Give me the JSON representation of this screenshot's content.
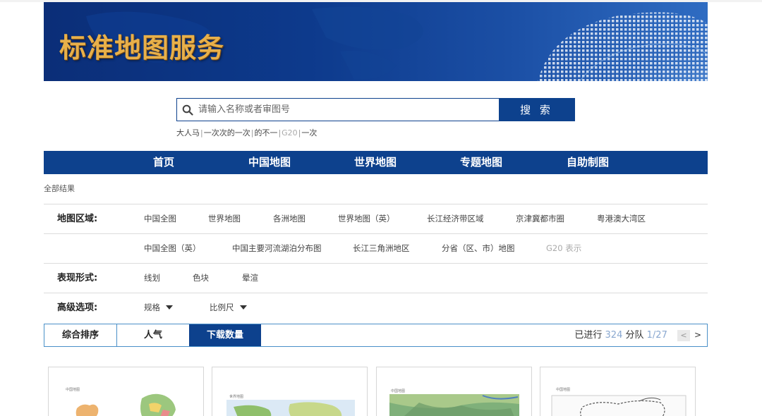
{
  "banner": {
    "title": "标准地图服务"
  },
  "search": {
    "placeholder": "请输入名称或者审图号",
    "button_label": "搜 索",
    "hot_words": [
      "大人马",
      "一次次的一次",
      "的不一",
      "G20",
      "一次"
    ]
  },
  "nav": {
    "items": [
      "首页",
      "中国地图",
      "世界地图",
      "专题地图",
      "自助制图"
    ]
  },
  "breadcrumb": "全部结果",
  "filters": {
    "region": {
      "label": "地图区域:",
      "row1": [
        "中国全图",
        "世界地图",
        "各洲地图",
        "世界地图（英）",
        "长江经济带区域",
        "京津冀都市圈",
        "粤港澳大湾区"
      ],
      "row2": [
        "中国全图（英）",
        "中国主要河流湖泊分布图",
        "长江三角洲地区",
        "分省（区、市）地图",
        "G20 表示"
      ]
    },
    "style": {
      "label": "表现形式:",
      "options": [
        "线划",
        "色块",
        "晕渲"
      ]
    },
    "advanced": {
      "label": "高级选项:",
      "options": [
        "规格",
        "比例尺"
      ]
    }
  },
  "sort": {
    "tabs": [
      "综合排序",
      "人气",
      "下载数量"
    ],
    "active": "下载数量"
  },
  "pager": {
    "prefix": "已进行",
    "total": "324",
    "mid": "分队",
    "page": "1/27",
    "prev": "<",
    "next": ">"
  },
  "cards": [
    {
      "title": "中国地图"
    },
    {
      "title": "世界地图"
    },
    {
      "title": "中国地图"
    },
    {
      "title": "中国地图"
    }
  ],
  "colors": {
    "brand": "#0d418d",
    "banner_title": "#e8b04a",
    "muted": "#aaaaaa"
  }
}
